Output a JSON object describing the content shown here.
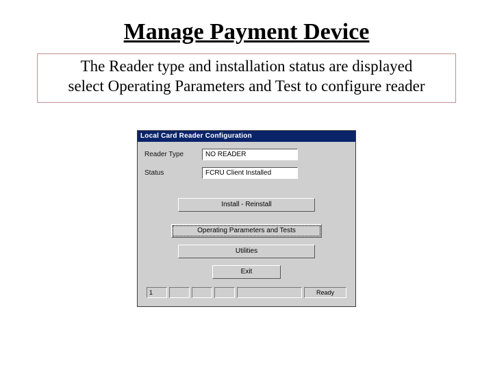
{
  "title": "Manage Payment Device",
  "description_line1": "The Reader type and installation status are displayed",
  "description_line2": "select Operating Parameters and Test to configure reader",
  "dialog": {
    "title": "Local Card Reader Configuration",
    "labels": {
      "reader_type": "Reader Type",
      "status": "Status"
    },
    "fields": {
      "reader_type": "NO READER",
      "status": "FCRU Client Installed"
    },
    "buttons": {
      "install": "Install - Reinstall",
      "ops": "Operating Parameters and Tests",
      "utilities": "Utilities",
      "exit": "Exit"
    },
    "status_panels": {
      "p1": "1",
      "ready": "Ready"
    }
  }
}
